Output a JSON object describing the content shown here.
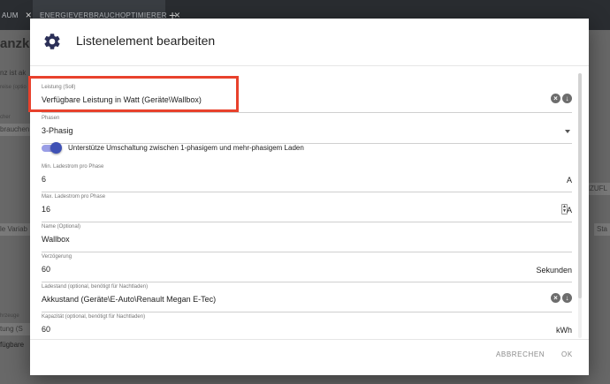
{
  "background": {
    "tabs": [
      {
        "label": "AUM"
      },
      {
        "label": "ENERGIEVERBRAUCHOPTIMIERER"
      }
    ],
    "add_tab": "+",
    "close_glyph": "×",
    "title": "anzko",
    "subtitle": "nz ist ak",
    "labels": [
      "reise (optio",
      "cher"
    ],
    "rows": [
      {
        "label": "brauchen"
      },
      {
        "label": "le Variab"
      },
      {
        "label": "hrzeuge"
      },
      {
        "label": "tung (S"
      },
      {
        "label": "fügbare"
      }
    ],
    "right_labels": [
      "NZUFL",
      "Sta"
    ]
  },
  "dialog": {
    "title": "Listenelement bearbeiten",
    "icon": "gear-icon",
    "fields": {
      "leistung": {
        "label": "Leistung (Soll)",
        "value": "Verfügbare Leistung in Watt (Geräte\\Wallbox)"
      },
      "phasen": {
        "label": "Phasen",
        "value": "3-Phasig"
      },
      "toggle": {
        "label": "Unterstütze Umschaltung zwischen 1-phasigem und mehr-phasigem Laden",
        "on": true
      },
      "min_strom": {
        "label": "Min. Ladestrom pro Phase",
        "value": "6",
        "unit": "A"
      },
      "max_strom": {
        "label": "Max. Ladestrom pro Phase",
        "value": "16",
        "unit": "A"
      },
      "name": {
        "label": "Name (Optional)",
        "value": "Wallbox"
      },
      "verzoegerung": {
        "label": "Verzögerung",
        "value": "60",
        "unit": "Sekunden"
      },
      "ladestand": {
        "label": "Ladestand (optional, benötigt für Nachtladen)",
        "value": "Akkustand (Geräte\\E-Auto\\Renault Megan E-Tec)"
      },
      "kapazitaet": {
        "label": "Kapazität (optional, benötigt für Nachtladen)",
        "value": "60",
        "unit": "kWh"
      }
    },
    "actions": {
      "cancel": "ABBRECHEN",
      "ok": "OK"
    }
  },
  "colors": {
    "accent": "#3f51b5",
    "highlight": "#e8412c"
  }
}
